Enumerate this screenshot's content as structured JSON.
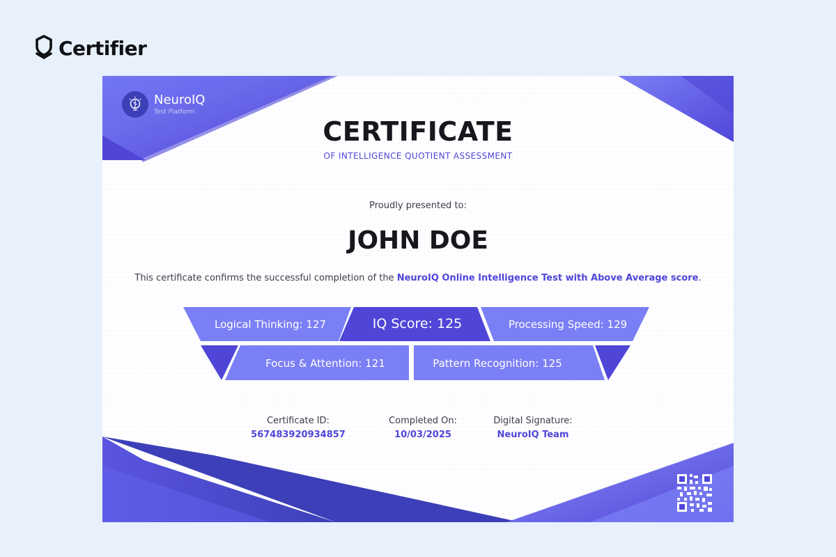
{
  "brand": {
    "name": "Certifier",
    "logo_icon": "certifier-shield-icon"
  },
  "certificate": {
    "issuer_logo": {
      "name": "NeuroIQ",
      "tagline": "Test Platform",
      "icon": "brain-bulb-icon"
    },
    "title": "CERTIFICATE",
    "subtitle": "OF INTELLIGENCE QUOTIENT ASSESSMENT",
    "presented_text": "Proudly presented to:",
    "recipient": "JOHN DOE",
    "statement_prefix": "This certificate confirms the successful completion of the ",
    "statement_highlight": "NeuroIQ Online Intelligence Test with Above Average score",
    "statement_suffix": ".",
    "scores": {
      "logical": "Logical Thinking: 127",
      "iq": "IQ Score: 125",
      "processing": "Processing Speed: 129",
      "focus": "Focus & Attention: 121",
      "pattern": "Pattern Recognition: 125"
    },
    "details": {
      "certificate_id_label": "Certificate ID:",
      "certificate_id_value": "567483920934857",
      "completed_label": "Completed On:",
      "completed_value": "10/03/2025",
      "signature_label": "Digital Signature:",
      "signature_value": "NeuroIQ Team"
    },
    "qr_icon": "qr-code-icon"
  },
  "colors": {
    "primary": "#4f46d8",
    "primary_light": "#7b7ff5",
    "primary_dark": "#3d3fb8",
    "background": "#e8f0fc",
    "text_dark": "#16181d"
  }
}
